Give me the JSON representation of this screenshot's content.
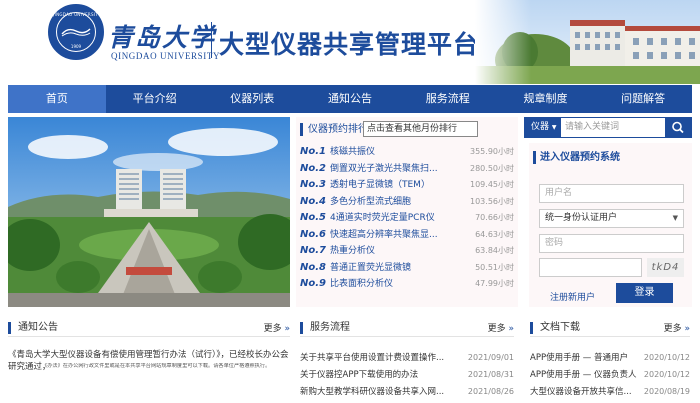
{
  "header": {
    "seal_ring": "QINGDAO UNIVERSITY",
    "seal_year": "1909",
    "university_cn": "青岛大学",
    "university_en": "QINGDAO UNIVERSITY",
    "platform_title": "大型仪器共享管理平台"
  },
  "nav": {
    "items": [
      "首页",
      "平台介绍",
      "仪器列表",
      "通知公告",
      "服务流程",
      "规章制度",
      "问题解答"
    ],
    "active_index": 0
  },
  "ranking": {
    "title": "仪器预约排行",
    "search_value": "点击查看其他月份排行",
    "rows": [
      {
        "no": "No.1",
        "name": "核磁共振仪",
        "hours": "355.90小时"
      },
      {
        "no": "No.2",
        "name": "倒置双光子激光共聚焦扫...",
        "hours": "280.50小时"
      },
      {
        "no": "No.3",
        "name": "透射电子显微镜（TEM）",
        "hours": "109.45小时"
      },
      {
        "no": "No.4",
        "name": "多色分析型流式细胞",
        "hours": "103.56小时"
      },
      {
        "no": "No.5",
        "name": "4通道实时荧光定量PCR仪",
        "hours": "70.66小时"
      },
      {
        "no": "No.6",
        "name": "快速超高分辨率共聚焦显...",
        "hours": "64.63小时"
      },
      {
        "no": "No.7",
        "name": "热重分析仪",
        "hours": "63.84小时"
      },
      {
        "no": "No.8",
        "name": "普通正置荧光显微镜",
        "hours": "50.51小时"
      },
      {
        "no": "No.9",
        "name": "比表面积分析仪",
        "hours": "47.99小时"
      }
    ]
  },
  "search": {
    "category": "仪器",
    "placeholder": "请输入关键词"
  },
  "login": {
    "title": "进入仪器预约系统",
    "username_placeholder": "用户名",
    "auth_option": "统一身份认证用户",
    "password_placeholder": "密码",
    "captcha_text": "tkD4",
    "register_label": "注册新用户",
    "login_label": "登录"
  },
  "notice": {
    "title": "通知公告",
    "more": "更多",
    "headline": "《青岛大学大型仪器设备有偿使用管理暂行办法（试行）》，已经校长办公会研究通过，",
    "summary": "《办法》在办公网行政文件里或是在本共享平台网站规章制度里可以下载。请各单位严格遵照执行。"
  },
  "service": {
    "title": "服务流程",
    "more": "更多",
    "rows": [
      {
        "title": "关于共享平台使用设置计费设置操作...",
        "date": "2021/09/01"
      },
      {
        "title": "关于仪器控APP下载使用的办法",
        "date": "2021/08/31"
      },
      {
        "title": "新购大型教学科研仪器设备共享入网...",
        "date": "2021/08/26"
      }
    ]
  },
  "docs": {
    "title": "文档下载",
    "more": "更多",
    "rows": [
      {
        "title": "APP使用手册 — 普通用户",
        "date": "2020/10/12"
      },
      {
        "title": "APP使用手册 — 仪器负责人",
        "date": "2020/10/12"
      },
      {
        "title": "大型仪器设备开放共享信...",
        "date": "2020/08/19"
      }
    ]
  },
  "colors": {
    "brand_blue": "#1d4c9c",
    "nav_active": "#3f73c8",
    "panel_pink": "#fdf7f8"
  }
}
